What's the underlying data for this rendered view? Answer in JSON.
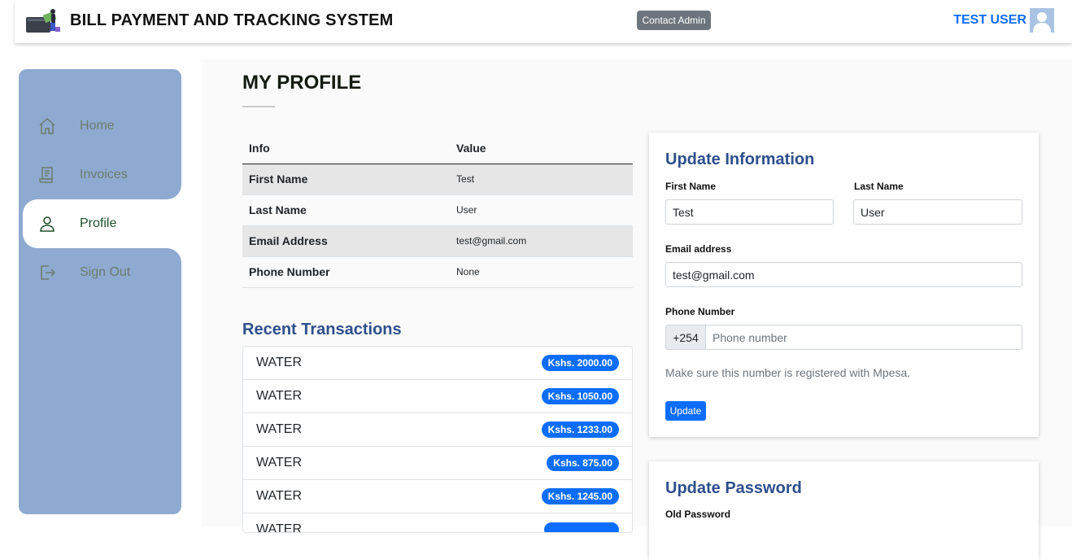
{
  "header": {
    "app_title": "BILL PAYMENT AND TRACKING SYSTEM",
    "contact_label": "Contact Admin",
    "user_name": "TEST USER"
  },
  "sidebar": {
    "items": [
      {
        "label": "Home",
        "icon": "home-icon",
        "active": false
      },
      {
        "label": "Invoices",
        "icon": "invoice-icon",
        "active": false
      },
      {
        "label": "Profile",
        "icon": "user-icon",
        "active": true
      },
      {
        "label": "Sign Out",
        "icon": "sign-out-icon",
        "active": false
      }
    ]
  },
  "main": {
    "title": "MY PROFILE",
    "info_table": {
      "headers": [
        "Info",
        "Value"
      ],
      "rows": [
        {
          "key": "First Name",
          "value": "Test"
        },
        {
          "key": "Last Name",
          "value": "User"
        },
        {
          "key": "Email Address",
          "value": "test@gmail.com"
        },
        {
          "key": "Phone Number",
          "value": "None"
        }
      ]
    },
    "recent_title": "Recent Transactions",
    "transactions": [
      {
        "name": "WATER",
        "amount": "Kshs. 2000.00"
      },
      {
        "name": "WATER",
        "amount": "Kshs. 1050.00"
      },
      {
        "name": "WATER",
        "amount": "Kshs. 1233.00"
      },
      {
        "name": "WATER",
        "amount": "Kshs. 875.00"
      },
      {
        "name": "WATER",
        "amount": "Kshs. 1245.00"
      },
      {
        "name": "WATER",
        "amount": ""
      }
    ]
  },
  "update_info": {
    "title": "Update Information",
    "first_name_label": "First Name",
    "first_name_value": "Test",
    "last_name_label": "Last Name",
    "last_name_value": "User",
    "email_label": "Email address",
    "email_value": "test@gmail.com",
    "phone_label": "Phone Number",
    "phone_prefix": "+254",
    "phone_placeholder": "Phone number",
    "help_text": "Make sure this number is registered with Mpesa.",
    "button_label": "Update"
  },
  "update_password": {
    "title": "Update Password",
    "old_password_label": "Old Password"
  },
  "colors": {
    "accent": "#0d6efd",
    "heading_blue": "#2d4f8c",
    "sidebar": "#8eaad1",
    "secondary": "#6c757d"
  }
}
